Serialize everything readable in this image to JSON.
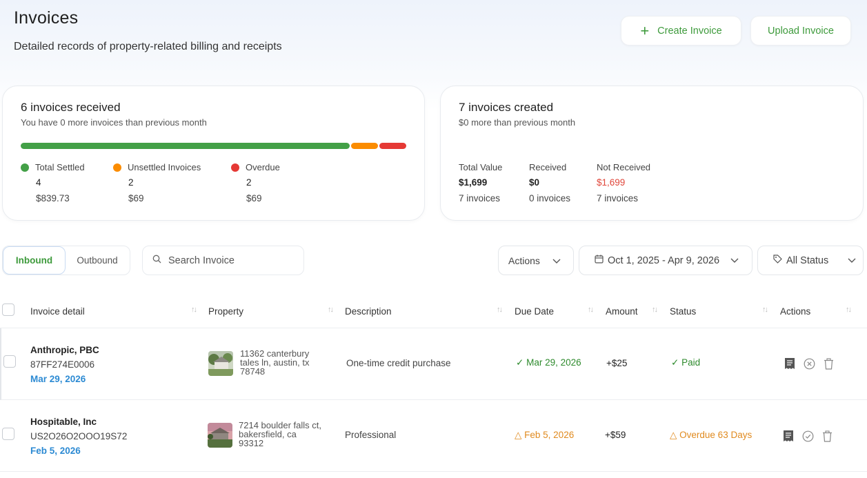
{
  "header": {
    "title": "Invoices",
    "subtitle": "Detailed records of property-related billing and receipts",
    "create_label": "Create Invoice",
    "upload_label": "Upload Invoice"
  },
  "received_card": {
    "title": "6 invoices received",
    "subtitle": "You have 0 more invoices than previous month",
    "legend": [
      {
        "label": "Total Settled",
        "count": "4",
        "amount": "$839.73",
        "color": "#43a047"
      },
      {
        "label": "Unsettled Invoices",
        "count": "2",
        "amount": "$69",
        "color": "#fb8c00"
      },
      {
        "label": "Overdue",
        "count": "2",
        "amount": "$69",
        "color": "#e53935"
      }
    ]
  },
  "created_card": {
    "title": "7 invoices created",
    "subtitle": "$0 more than previous month",
    "stats": [
      {
        "label": "Total Value",
        "value": "$1,699",
        "count": "7 invoices"
      },
      {
        "label": "Received",
        "value": "$0",
        "count": "0 invoices"
      },
      {
        "label": "Not Received",
        "value": "$1,699",
        "count": "7 invoices"
      }
    ]
  },
  "toolbar": {
    "tab_inbound": "Inbound",
    "tab_outbound": "Outbound",
    "search_placeholder": "Search Invoice",
    "actions_label": "Actions",
    "date_range": "Oct 1, 2025 - Apr 9, 2026",
    "status_filter": "All Status"
  },
  "table": {
    "columns": [
      "Invoice detail",
      "Property",
      "Description",
      "Due Date",
      "Amount",
      "Status",
      "Actions"
    ],
    "rows": [
      {
        "company": "Anthropic, PBC",
        "invoice_id": "87FF274E0006",
        "invoice_date": "Mar 29, 2026",
        "address": "11362 canterbury tales ln, austin, tx 78748",
        "description": "One-time credit purchase",
        "due_date": "Mar 29, 2026",
        "amount": "+$25",
        "status": "Paid"
      },
      {
        "company": "Hospitable, Inc",
        "invoice_id": "US2O26O2OOO19S72",
        "invoice_date": "Feb 5, 2026",
        "address": "7214 boulder falls ct, bakersfield, ca 93312",
        "description": "Professional",
        "due_date": "Feb 5, 2026",
        "amount": "+$59",
        "status": "Overdue 63 Days"
      }
    ]
  }
}
